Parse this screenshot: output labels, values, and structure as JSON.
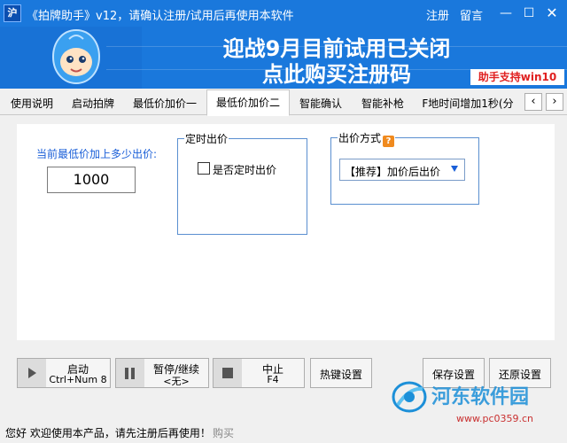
{
  "titlebar": {
    "app_icon": "沪",
    "title": "《拍牌助手》v12，请确认注册/试用后再使用本软件",
    "register_link": "注册",
    "message_link": "留言",
    "minimize_glyph": "—",
    "maximize_glyph": "☐",
    "close_glyph": "✕"
  },
  "banner": {
    "headline": "迎战9月目前试用已关闭",
    "cta": "点此购买注册码",
    "badge": "助手支持win10"
  },
  "tabs": [
    {
      "label": "使用说明"
    },
    {
      "label": "启动拍牌"
    },
    {
      "label": "最低价加价一"
    },
    {
      "label": "最低价加价二",
      "active": true
    },
    {
      "label": "智能确认"
    },
    {
      "label": "智能补枪"
    },
    {
      "label": "F地时间增加1秒(分"
    }
  ],
  "tab_scroll": {
    "left": "‹",
    "right": "›"
  },
  "form": {
    "min_add_label": "当前最低价加上多少出价:",
    "amount_value": "1000",
    "timed_group_title": "定时出价",
    "timed_checkbox_label": "是否定时出价",
    "method_group_title": "出价方式",
    "help_glyph": "?",
    "method_selected": "【推荐】加价后出价"
  },
  "buttons": {
    "start_label": "启动",
    "start_hotkey": "Ctrl+Num 8",
    "pause_label": "暂停/继续",
    "pause_hotkey": "<无>",
    "stop_label": "中止",
    "stop_hotkey": "F4",
    "hotkey_settings": "热键设置",
    "save_settings": "保存设置",
    "restore_settings": "还原设置"
  },
  "watermark": {
    "text": "河东软件园",
    "url": "www.pc0359.cn"
  },
  "statusbar": {
    "message": "您好 欢迎使用本产品，请先注册后再使用！",
    "buy_link": "购买"
  },
  "colors": {
    "titlebar_bg": "#1a78dc",
    "accent_blue": "#1a5fd8",
    "badge_red": "#e02020"
  }
}
